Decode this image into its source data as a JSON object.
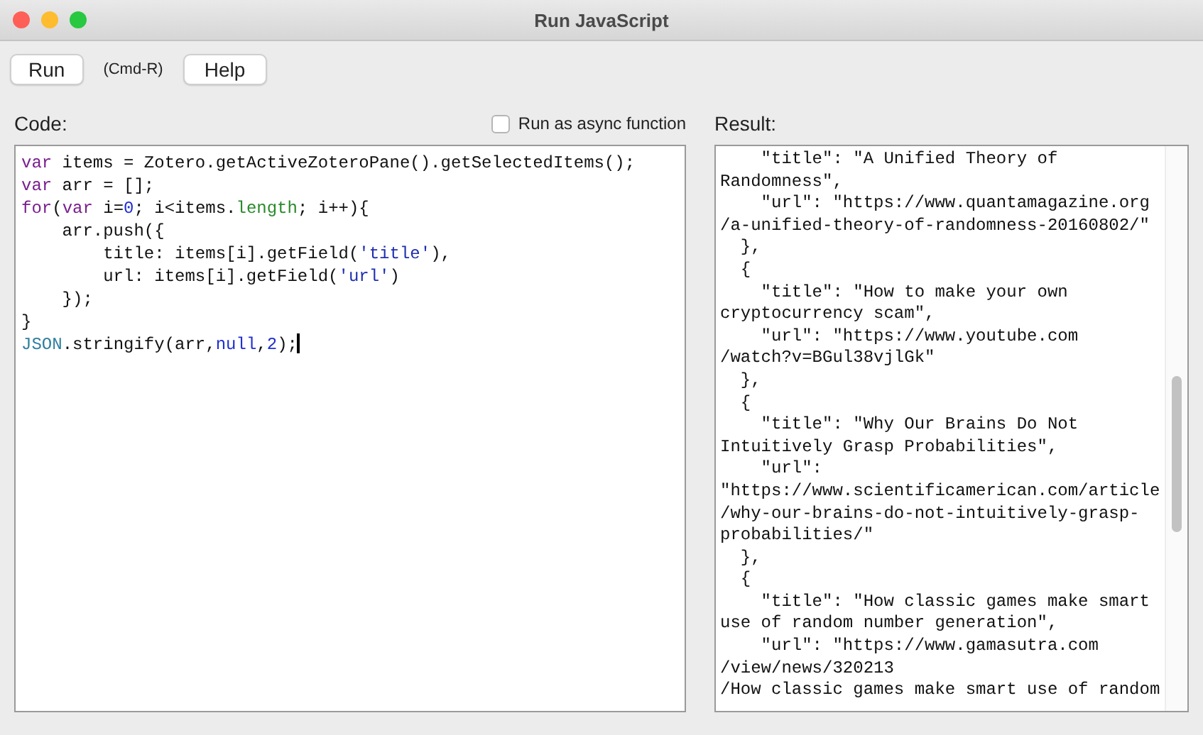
{
  "window": {
    "title": "Run JavaScript"
  },
  "toolbar": {
    "run_button": "Run",
    "shortcut": "(Cmd-R)",
    "help_button": "Help"
  },
  "code_label": "Code:",
  "async_option": {
    "label": "Run as async function",
    "checked": false
  },
  "result_label": "Result:",
  "code_lines": [
    [
      {
        "kind": "keyword",
        "text": "var"
      },
      {
        "kind": "plain",
        "text": " items = Zotero.getActiveZoteroPane().getSelectedItems();"
      }
    ],
    [
      {
        "kind": "keyword",
        "text": "var"
      },
      {
        "kind": "plain",
        "text": " arr = [];"
      }
    ],
    [
      {
        "kind": "keyword",
        "text": "for"
      },
      {
        "kind": "plain",
        "text": "("
      },
      {
        "kind": "keyword",
        "text": "var"
      },
      {
        "kind": "plain",
        "text": " i="
      },
      {
        "kind": "number",
        "text": "0"
      },
      {
        "kind": "plain",
        "text": "; i<items."
      },
      {
        "kind": "property",
        "text": "length"
      },
      {
        "kind": "plain",
        "text": "; i++){"
      }
    ],
    [
      {
        "kind": "plain",
        "text": "    arr.push({"
      }
    ],
    [
      {
        "kind": "plain",
        "text": "        title: items[i].getField("
      },
      {
        "kind": "string",
        "text": "'title'"
      },
      {
        "kind": "plain",
        "text": "),"
      }
    ],
    [
      {
        "kind": "plain",
        "text": "        url: items[i].getField("
      },
      {
        "kind": "string",
        "text": "'url'"
      },
      {
        "kind": "plain",
        "text": ")"
      }
    ],
    [
      {
        "kind": "plain",
        "text": "    });"
      }
    ],
    [
      {
        "kind": "plain",
        "text": "}"
      }
    ],
    [
      {
        "kind": "builtin",
        "text": "JSON"
      },
      {
        "kind": "plain",
        "text": ".stringify(arr,"
      },
      {
        "kind": "atom",
        "text": "null"
      },
      {
        "kind": "plain",
        "text": ","
      },
      {
        "kind": "number",
        "text": "2"
      },
      {
        "kind": "plain",
        "text": ");"
      }
    ]
  ],
  "result_lines": [
    "    \"title\": \"A Unified Theory of",
    "Randomness\",",
    "    \"url\": \"https://www.quantamagazine.org",
    "/a-unified-theory-of-randomness-20160802/\"",
    "  },",
    "  {",
    "    \"title\": \"How to make your own",
    "cryptocurrency scam\",",
    "    \"url\": \"https://www.youtube.com",
    "/watch?v=BGul38vjlGk\"",
    "  },",
    "  {",
    "    \"title\": \"Why Our Brains Do Not",
    "Intuitively Grasp Probabilities\",",
    "    \"url\":",
    "\"https://www.scientificamerican.com/article",
    "/why-our-brains-do-not-intuitively-grasp-",
    "probabilities/\"",
    "  },",
    "  {",
    "    \"title\": \"How classic games make smart",
    "use of random number generation\",",
    "    \"url\": \"https://www.gamasutra.com",
    "/view/news/320213",
    "/How classic games make smart use of random"
  ]
}
